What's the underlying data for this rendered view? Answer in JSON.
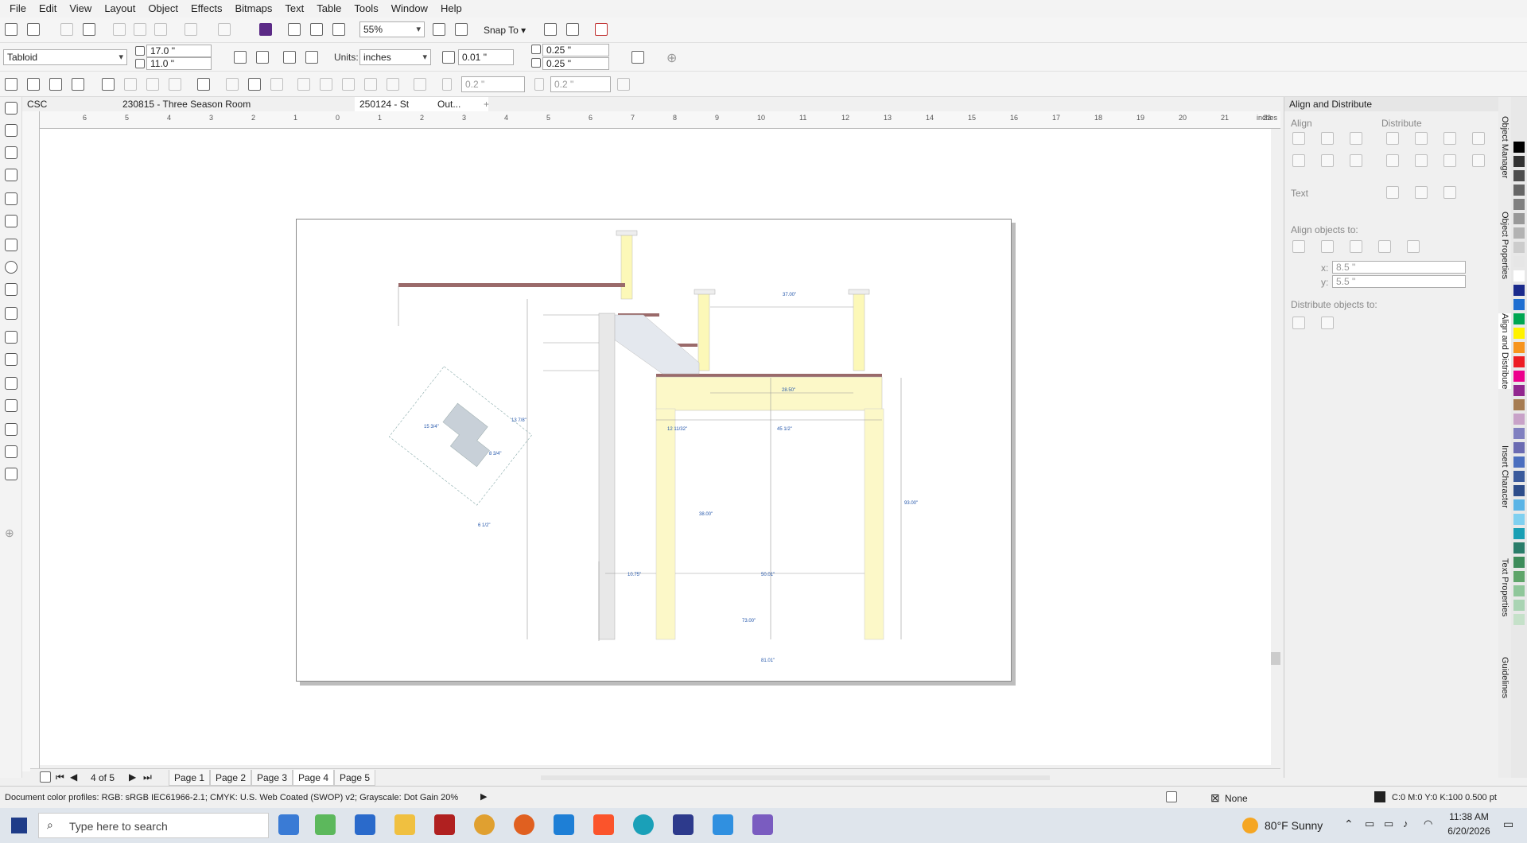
{
  "menu": [
    "File",
    "Edit",
    "View",
    "Layout",
    "Object",
    "Effects",
    "Bitmaps",
    "Text",
    "Table",
    "Tools",
    "Window",
    "Help"
  ],
  "toolbar": {
    "zoom": "55%",
    "snap_to": "Snap To"
  },
  "property_bar": {
    "paper_size": "Tabloid",
    "width": "17.0 \"",
    "height": "11.0 \"",
    "units_label": "Units:",
    "units": "inches",
    "nudge": "0.01 \"",
    "dup_x": "0.25 \"",
    "dup_y": "0.25 \"",
    "outline1": "0.2 \"",
    "outline2": "0.2 \""
  },
  "doc_tabs": [
    "CSC",
    "230815 - Three Season Room",
    "250124 - St",
    "Out..."
  ],
  "ruler": {
    "unit": "inches",
    "h_labels": [
      "6",
      "5",
      "4",
      "3",
      "2",
      "1",
      "0",
      "1",
      "2",
      "3",
      "4",
      "5",
      "6",
      "7",
      "8",
      "9",
      "10",
      "11",
      "12",
      "13",
      "14",
      "15",
      "16",
      "17",
      "18",
      "19",
      "20",
      "21",
      "22"
    ]
  },
  "drawing_labels": {
    "l1": "37.00\"",
    "l2": "28.50\"",
    "l3": "12 11/32\"",
    "l4": "45 1/2\"",
    "l5": "38.00\"",
    "l6": "93.00\"",
    "l7": "10.75\"",
    "l8": "50.01\"",
    "l9": "73.00\"",
    "l10": "81.01\"",
    "d1": "15 3/4\"",
    "d2": "8 3/4\"",
    "d3": "13 7/8\"",
    "d4": "6 1/2\""
  },
  "page_nav": {
    "counter": "4 of 5",
    "pages": [
      "Page 1",
      "Page 2",
      "Page 3",
      "Page 4",
      "Page 5"
    ],
    "active": "Page 4"
  },
  "docker": {
    "title": "Align and Distribute",
    "align": "Align",
    "distribute": "Distribute",
    "text": "Text",
    "align_objects_to": "Align objects to:",
    "x_label": "x:",
    "x_value": "8.5 \"",
    "y_label": "y:",
    "y_value": "5.5 \"",
    "distribute_objects_to": "Distribute objects to:"
  },
  "vertical_tabs": [
    "Object Manager",
    "Object Properties",
    "Align and Distribute",
    "Insert Character",
    "Text Properties",
    "Guidelines"
  ],
  "palette_colors": [
    "#000000",
    "#333333",
    "#4d4d4d",
    "#666666",
    "#808080",
    "#999999",
    "#b3b3b3",
    "#cccccc",
    "#e6e6e6",
    "#ffffff",
    "#1b2a8c",
    "#1f6fd1",
    "#00a651",
    "#fff200",
    "#f7941d",
    "#ed1c24",
    "#ec008c",
    "#92278f",
    "#a67c52",
    "#c8a2c8",
    "#8080c0",
    "#6b6bb2",
    "#4b6fbf",
    "#3a5a9c",
    "#2d4d8a",
    "#5ab4e6",
    "#7fd0f0",
    "#1a9fb4",
    "#2a7d6a",
    "#3d8c5a",
    "#5fa56a",
    "#8fc79a",
    "#a9d4b3",
    "#c5e1c9"
  ],
  "status": {
    "profiles": "Document color profiles: RGB: sRGB IEC61966-2.1; CMYK: U.S. Web Coated (SWOP) v2; Grayscale: Dot Gain 20%",
    "fill": "None",
    "outline": "C:0 M:0 Y:0 K:100  0.500 pt"
  },
  "taskbar": {
    "search": "Type here to search",
    "weather": "80°F  Sunny",
    "time": "11:38 AM",
    "date": "6/20/2026"
  }
}
